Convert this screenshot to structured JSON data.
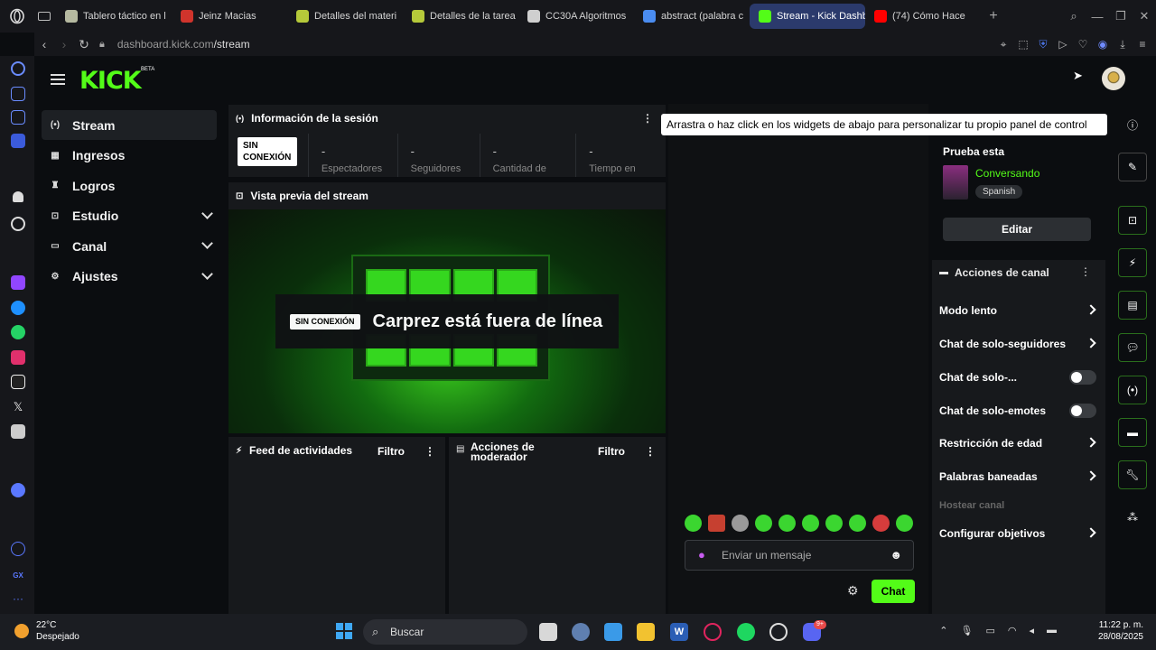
{
  "browser": {
    "tabs": [
      {
        "title": "Tablero táctico en l",
        "fav_color": "#b5b9a0"
      },
      {
        "title": "Jeinz Macias",
        "fav_color": "#d0342c"
      },
      {
        "title": "Detalles del materi",
        "fav_color": "#b5c93a"
      },
      {
        "title": "Detalles de la tarea",
        "fav_color": "#b5c93a"
      },
      {
        "title": "CC30A Algoritmos",
        "fav_color": "#cfcfcf"
      },
      {
        "title": "abstract (palabra c",
        "fav_color": "#4a8cf0"
      },
      {
        "title": "Stream - Kick Dashboard",
        "fav_color": "#53fc18"
      },
      {
        "title": "(74) Cómo Hace",
        "fav_color": "#ff0000"
      }
    ],
    "url_host": "dashboard.kick.com",
    "url_path": "/stream"
  },
  "logo": {
    "text": "KICK",
    "beta": "BETA"
  },
  "nav": {
    "items": [
      {
        "label": "Stream",
        "icon": "broadcast-icon",
        "glyph": "(•)"
      },
      {
        "label": "Ingresos",
        "icon": "chart-icon",
        "glyph": "▦"
      },
      {
        "label": "Logros",
        "icon": "trophy-icon",
        "glyph": "♜"
      },
      {
        "label": "Estudio",
        "icon": "studio-icon",
        "glyph": "⊡"
      },
      {
        "label": "Canal",
        "icon": "channel-icon",
        "glyph": "▭"
      },
      {
        "label": "Ajustes",
        "icon": "gear-icon",
        "glyph": "⚙"
      }
    ]
  },
  "session": {
    "title": "Información de la sesión",
    "status": "SIN CONEXIÓN",
    "stats": [
      {
        "value": "-",
        "label": "Espectadores"
      },
      {
        "value": "-",
        "label": "Seguidores"
      },
      {
        "value": "-",
        "label": "Cantidad de"
      },
      {
        "value": "-",
        "label": "Tiempo en"
      }
    ]
  },
  "preview": {
    "title": "Vista previa del stream",
    "badge": "SIN CONEXIÓN",
    "offline_text": "Carprez está fuera de línea"
  },
  "feed": {
    "title": "Feed de actividades",
    "filter": "Filtro"
  },
  "modactions": {
    "title_line1": "Acciones de",
    "title_line2": "moderador",
    "filter": "Filtro"
  },
  "hint": "Arrastra o haz click en los widgets de abajo para personalizar tu propio panel de control",
  "try": {
    "label": "Prueba esta",
    "category": "Conversando",
    "tag": "Spanish",
    "edit": "Editar"
  },
  "channel_actions": {
    "title": "Acciones de canal",
    "rows": [
      {
        "label": "Modo lento",
        "kind": "arrow"
      },
      {
        "label": "Chat de solo-seguidores",
        "kind": "arrow"
      },
      {
        "label": "Chat de solo-...",
        "kind": "toggle"
      },
      {
        "label": "Chat de solo-emotes",
        "kind": "toggle"
      },
      {
        "label": "Restricción de edad",
        "kind": "arrow"
      },
      {
        "label": "Palabras baneadas",
        "kind": "arrow"
      },
      {
        "label": "Hostear canal",
        "kind": "disabled"
      },
      {
        "label": "Configurar objetivos",
        "kind": "arrow"
      }
    ]
  },
  "chat": {
    "placeholder": "Enviar un mensaje",
    "send": "Chat"
  },
  "taskbar": {
    "temp": "22°C",
    "weather": "Despejado",
    "search": "Buscar",
    "time": "11:22 p. m.",
    "date": "28/08/2025",
    "discord_badge": "9+"
  },
  "colors": {
    "accent": "#53fc18",
    "tab_active": "#2b3a6c"
  }
}
